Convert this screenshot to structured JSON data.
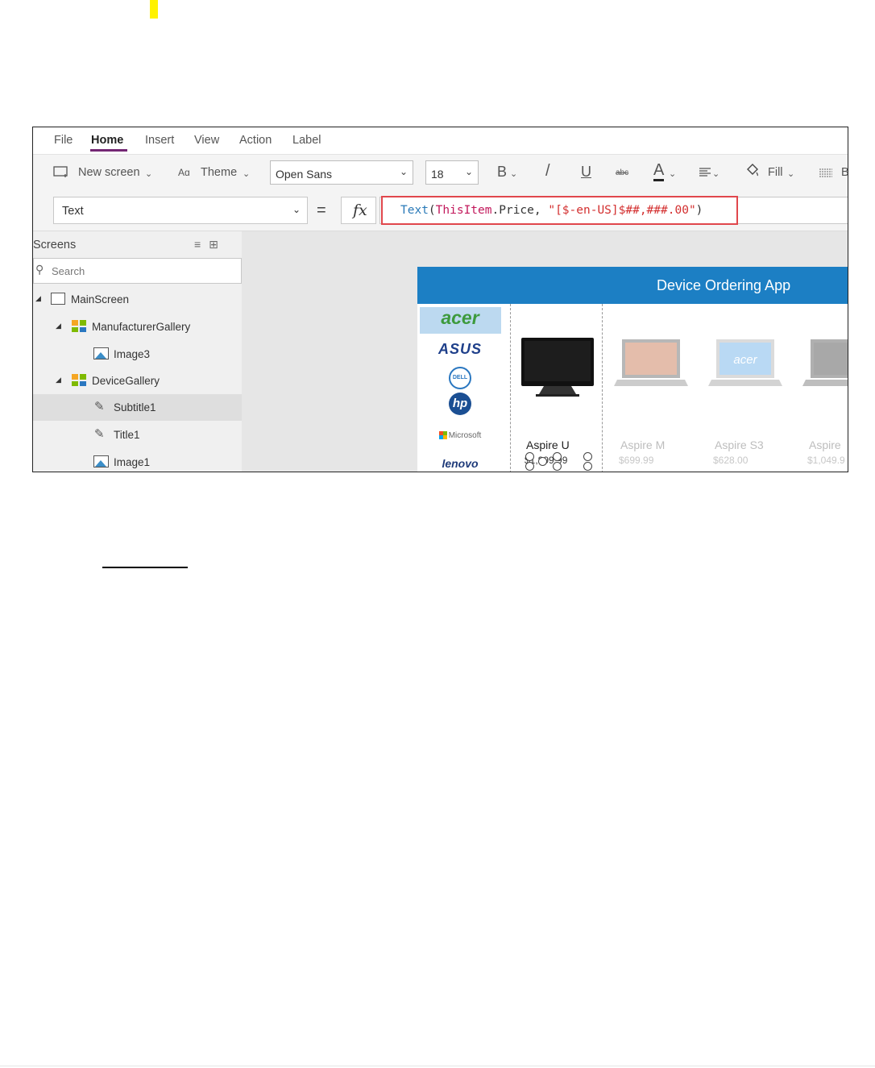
{
  "menu": {
    "items": [
      {
        "label": "File"
      },
      {
        "label": "Home"
      },
      {
        "label": "Insert"
      },
      {
        "label": "View"
      },
      {
        "label": "Action"
      },
      {
        "label": "Label"
      }
    ],
    "active": "Home"
  },
  "toolbar": {
    "new_screen_label": "New screen",
    "theme_label": "Theme",
    "font_family_value": "Open Sans",
    "font_size_value": "18",
    "bold_label": "B",
    "italic_label": "/",
    "underline_label": "U",
    "strikethrough_label": "abc",
    "font_color_label": "A",
    "fill_label": "Fill",
    "border_label": "B",
    "icons": [
      "new-screen-icon",
      "theme-icon",
      "align-icon",
      "fill-bucket-icon",
      "border-icon"
    ]
  },
  "formula_bar": {
    "property_value": "Text",
    "equals": "=",
    "fx": "fx",
    "formula": {
      "fn": "Text",
      "open": "(",
      "ref": "ThisItem",
      "member": ".Price, ",
      "str": "\"[$-en-US]$##,###.00\"",
      "close": ")"
    },
    "highlight_color": "#e0474c"
  },
  "tree": {
    "header": "Screens",
    "search_placeholder": "Search",
    "nodes": [
      {
        "label": "MainScreen",
        "icon": "screen-icon"
      },
      {
        "label": "ManufacturerGallery",
        "icon": "gallery-icon"
      },
      {
        "label": "Image3",
        "icon": "image-icon"
      },
      {
        "label": "DeviceGallery",
        "icon": "gallery-icon"
      },
      {
        "label": "Subtitle1",
        "icon": "edit-label-icon",
        "selected": true
      },
      {
        "label": "Title1",
        "icon": "edit-label-icon"
      },
      {
        "label": "Image1",
        "icon": "image-icon"
      }
    ]
  },
  "app": {
    "title": "Device Ordering App",
    "header_color": "#1c7fc4",
    "manufacturers": [
      "acer",
      "ASUS",
      "DELL",
      "hp",
      "Microsoft",
      "lenovo"
    ],
    "selected_manufacturer": "acer",
    "devices": [
      {
        "name": "Aspire U",
        "price": "$1,899.99"
      },
      {
        "name": "Aspire M",
        "price": "$699.99"
      },
      {
        "name": "Aspire S3",
        "price": "$628.00"
      },
      {
        "name": "Aspire",
        "price": "$1,049.9"
      }
    ]
  },
  "colors": {
    "accent_purple": "#742774",
    "highlight_yellow": "#fff200"
  }
}
